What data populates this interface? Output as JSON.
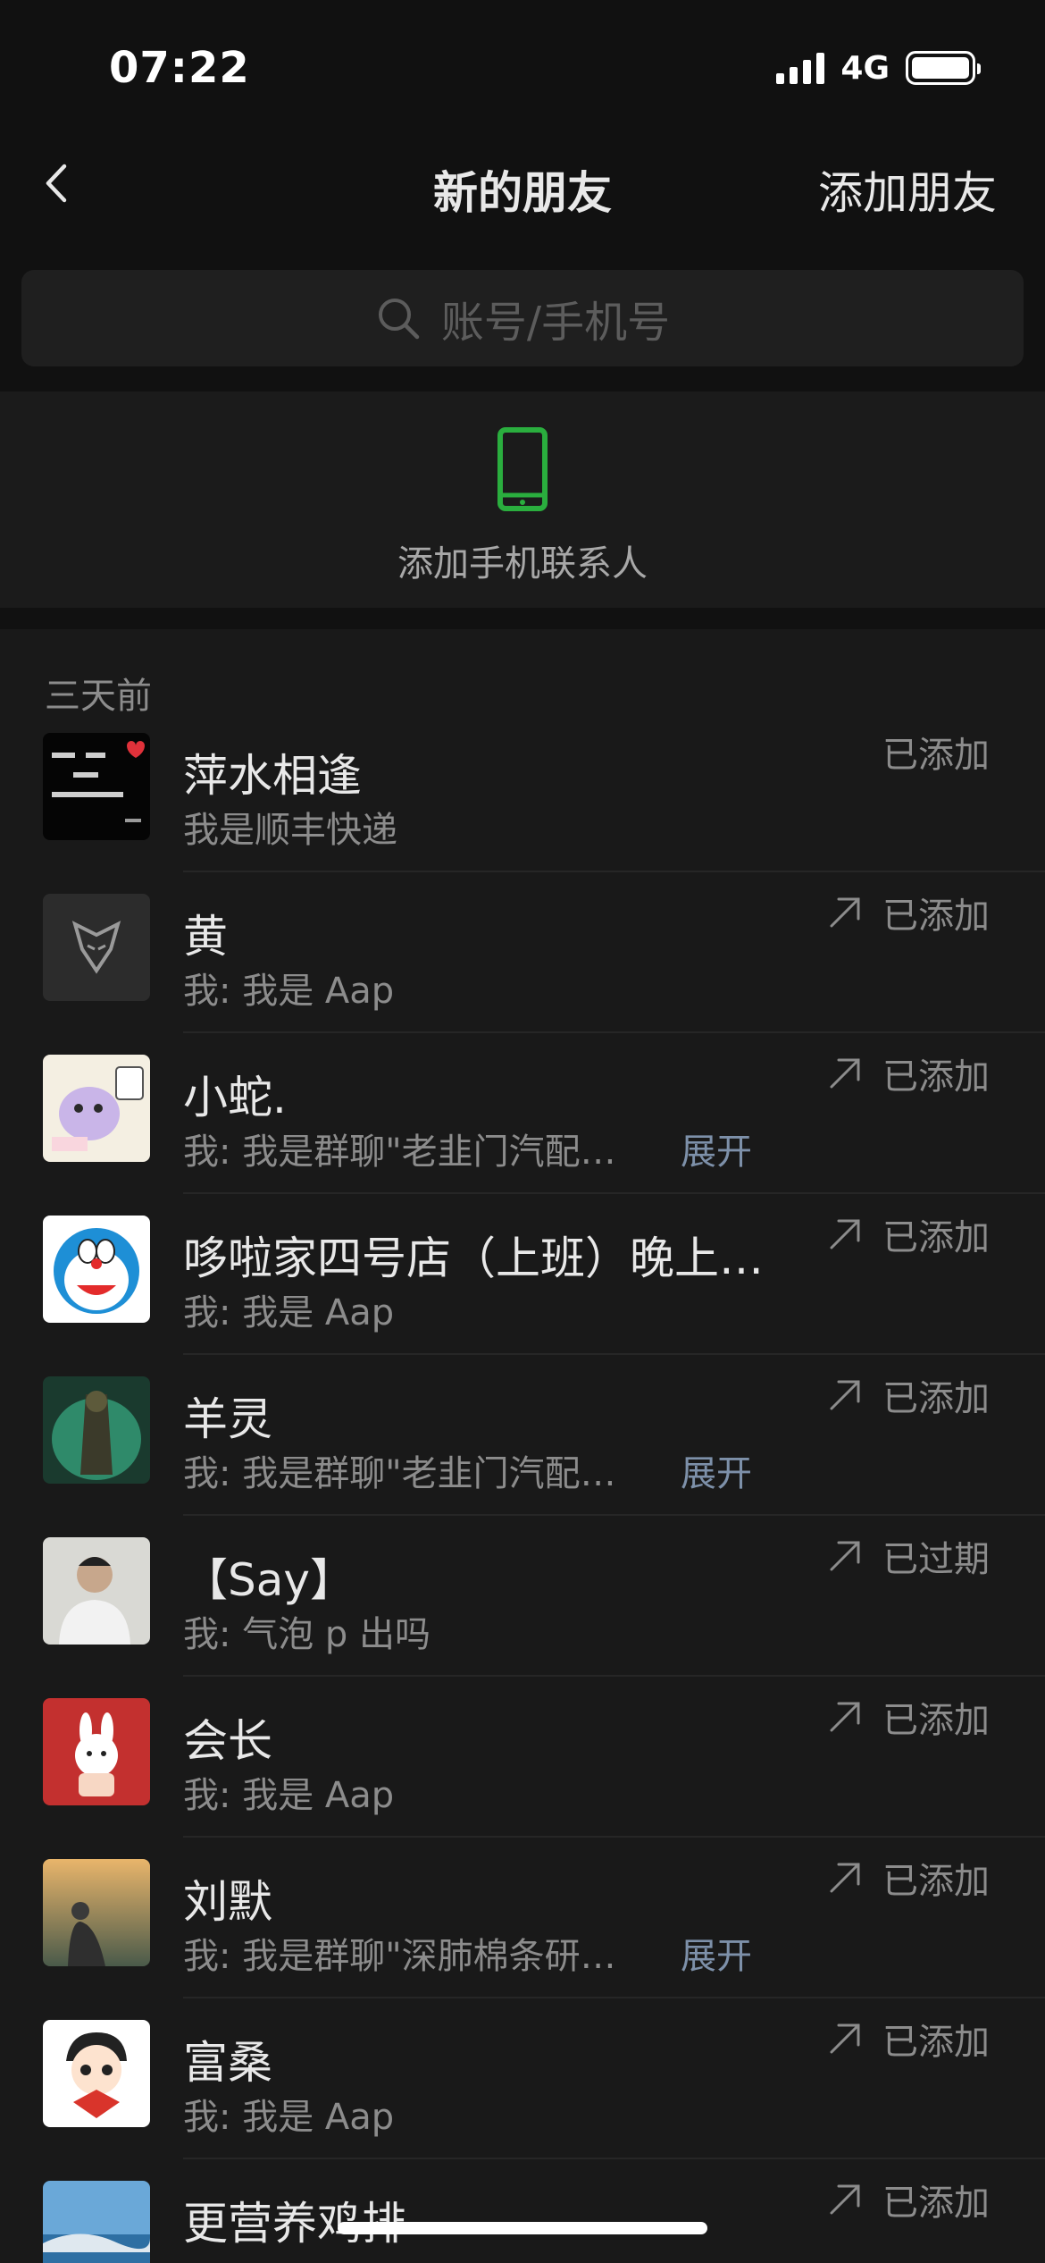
{
  "status_bar": {
    "time": "07:22",
    "network": "4G"
  },
  "nav": {
    "title": "新的朋友",
    "action": "添加朋友"
  },
  "search": {
    "placeholder": "账号/手机号"
  },
  "add_phone": {
    "label": "添加手机联系人",
    "icon": "phone-icon",
    "icon_color": "#2aae3e"
  },
  "section": {
    "header": "三天前"
  },
  "colors": {
    "accent_green": "#2aae3e",
    "expand_link": "#7d90a9",
    "secondary_text": "#8c8c8c"
  },
  "requests": [
    {
      "name": "萍水相逢",
      "message": "我是顺丰快递",
      "expand": "",
      "status": "已添加",
      "arrow": false
    },
    {
      "name": "黄",
      "message": "我: 我是 Aap",
      "expand": "",
      "status": "已添加",
      "arrow": true
    },
    {
      "name": "小蛇.",
      "message": "我: 我是群聊\"老韭门汽配…",
      "expand": "展开",
      "status": "已添加",
      "arrow": true
    },
    {
      "name": "哆啦家四号店（上班）晚上…",
      "message": "我: 我是 Aap",
      "expand": "",
      "status": "已添加",
      "arrow": true
    },
    {
      "name": "羊灵",
      "message": "我: 我是群聊\"老韭门汽配…",
      "expand": "展开",
      "status": "已添加",
      "arrow": true
    },
    {
      "name": "【Say】",
      "message": "我: 气泡 p 出吗",
      "expand": "",
      "status": "已过期",
      "arrow": true
    },
    {
      "name": "会长",
      "message": "我: 我是 Aap",
      "expand": "",
      "status": "已添加",
      "arrow": true
    },
    {
      "name": "刘默",
      "message": "我: 我是群聊\"深肺棉条研…",
      "expand": "展开",
      "status": "已添加",
      "arrow": true
    },
    {
      "name": "富桑",
      "message": "我: 我是 Aap",
      "expand": "",
      "status": "已添加",
      "arrow": true
    },
    {
      "name": "更营养鸡排",
      "message": "",
      "expand": "",
      "status": "已添加",
      "arrow": true
    }
  ]
}
